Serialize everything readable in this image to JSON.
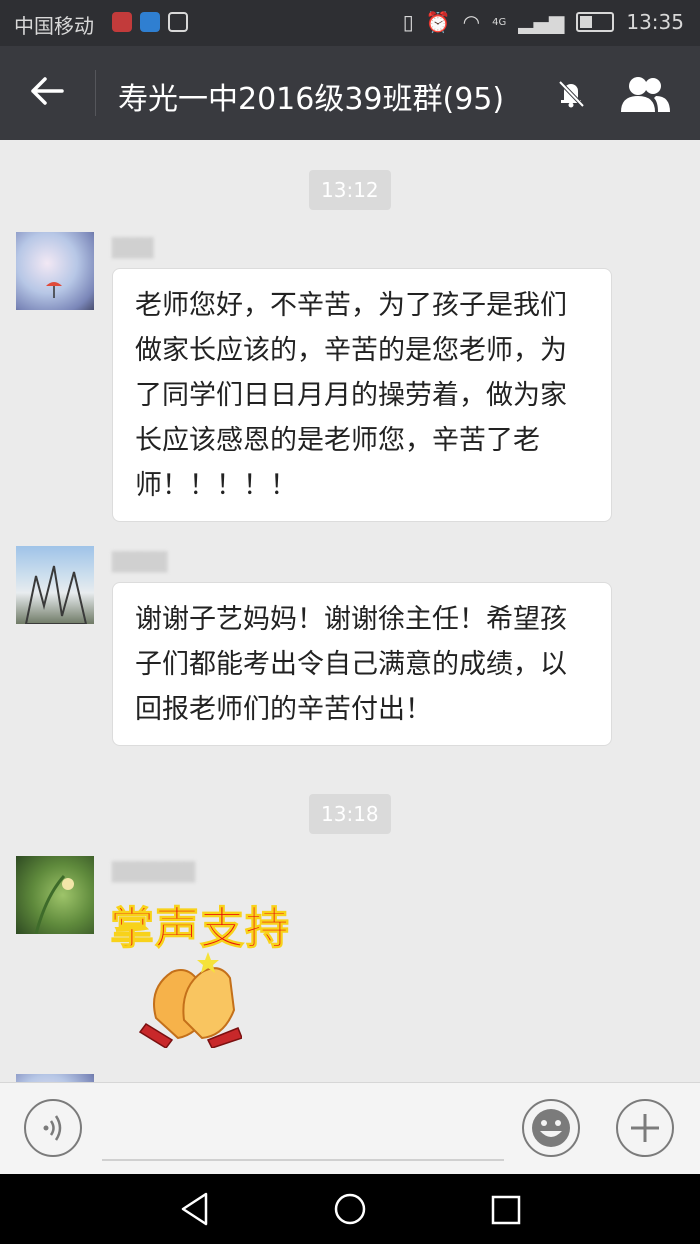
{
  "status_bar": {
    "carrier": "中国移动",
    "clock": "13:35",
    "network": "4G"
  },
  "header": {
    "title": "寿光一中2016级39班群(95)"
  },
  "chat": {
    "time_1": "13:12",
    "time_2": "13:18",
    "messages": [
      {
        "text": "老师您好，不辛苦，为了孩子是我们做家长应该的，辛苦的是您老师，为了同学们日日月月的操劳着，做为家长应该感恩的是老师您，辛苦了老师！！！！！"
      },
      {
        "text": "谢谢子艺妈妈！谢谢徐主任！希望孩子们都能考出令自己满意的成绩，以回报老师们的辛苦付出！"
      }
    ],
    "sticker_text": "掌声支持"
  },
  "colors": {
    "header_bg": "#393a3f",
    "status_bg": "#2e2f33",
    "chat_bg": "#ebebeb",
    "sticker_red": "#e8120c"
  }
}
